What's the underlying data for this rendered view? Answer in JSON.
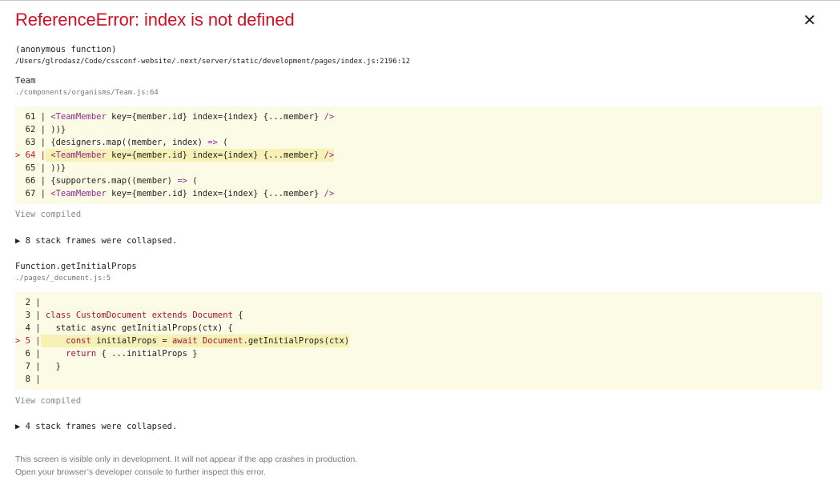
{
  "error": {
    "title": "ReferenceError: index is not defined",
    "close_symbol": "✕"
  },
  "frames": [
    {
      "name": "(anonymous function)",
      "path": "/Users/glrodasz/Code/cssconf-website/.next/server/static/development/pages/index.js:2196:12"
    },
    {
      "name": "Team",
      "path": "./components/organisms/Team.js:64",
      "code": [
        {
          "prefix": "  61 |",
          "text": "   <TeamMember key={member.id} index={index} {...member} />"
        },
        {
          "prefix": "  62 |",
          "text": " ))}"
        },
        {
          "prefix": "  63 |",
          "text": " {designers.map((member, index) => ("
        },
        {
          "prefix": "> 64 |",
          "text": "   <TeamMember key={member.id} index={index} {...member} />",
          "highlight": true
        },
        {
          "prefix": "  65 |",
          "text": " ))}"
        },
        {
          "prefix": "  66 |",
          "text": " {supporters.map((member) => ("
        },
        {
          "prefix": "  67 |",
          "text": "   <TeamMember key={member.id} index={index} {...member} />"
        }
      ],
      "view_compiled": "View compiled",
      "collapsed": "▶ 8 stack frames were collapsed."
    },
    {
      "name": "Function.getInitialProps",
      "path": "./pages/_document.js:5",
      "code": [
        {
          "prefix": "  2 |",
          "text": ""
        },
        {
          "prefix": "  3 |",
          "text": " class CustomDocument extends Document {"
        },
        {
          "prefix": "  4 |",
          "text": "   static async getInitialProps(ctx) {"
        },
        {
          "prefix": "> 5 |",
          "text": "     const initialProps = await Document.getInitialProps(ctx)",
          "highlight": true
        },
        {
          "prefix": "  6 |",
          "text": "     return { ...initialProps }"
        },
        {
          "prefix": "  7 |",
          "text": "   }"
        },
        {
          "prefix": "  8 |",
          "text": ""
        }
      ],
      "view_compiled": "View compiled",
      "collapsed": "▶ 4 stack frames were collapsed."
    }
  ],
  "footer": {
    "line1": "This screen is visible only in development. It will not appear if the app crashes in production.",
    "line2": "Open your browser’s developer console to further inspect this error."
  }
}
